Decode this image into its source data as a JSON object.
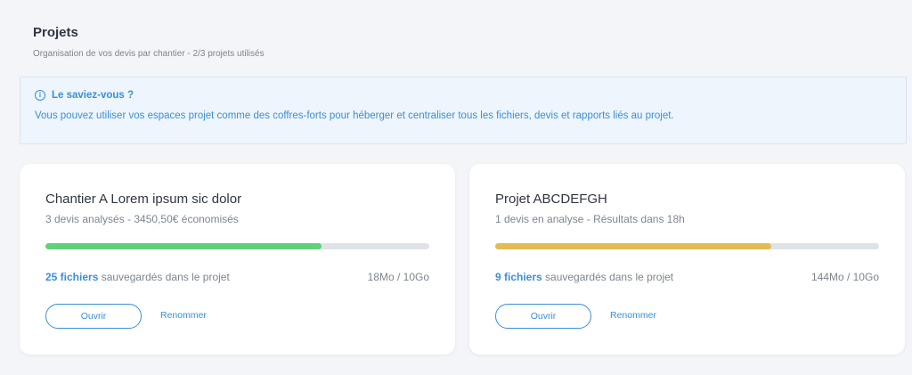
{
  "header": {
    "title": "Projets",
    "subtitle": "Organisation de vos devis par chantier - 2/3 projets utilisés"
  },
  "info": {
    "icon": "info-icon",
    "title": "Le saviez-vous ?",
    "text": "Vous pouvez utiliser vos espaces projet comme des coffres-forts pour héberger et centraliser tous les fichiers, devis et rapports liés au projet."
  },
  "projects": [
    {
      "title": "Chantier A Lorem ipsum sic dolor",
      "subtitle": "3 devis analysés - 3450,50€ économisés",
      "progress": 0.72,
      "progress_color": "#5fd17a",
      "files_count": "25 fichiers",
      "files_suffix": " sauvegardés dans le projet",
      "storage": "18Mo / 10Go",
      "open_label": "Ouvrir",
      "rename_label": "Renommer"
    },
    {
      "title": "Projet ABCDEFGH",
      "subtitle": "1 devis en analyse - Résultats dans 18h",
      "progress": 0.72,
      "progress_color": "#e2bb55",
      "files_count": "9 fichiers",
      "files_suffix": " sauvegardés dans le projet",
      "storage": "144Mo / 10Go",
      "open_label": "Ouvrir",
      "rename_label": "Renommer"
    }
  ]
}
